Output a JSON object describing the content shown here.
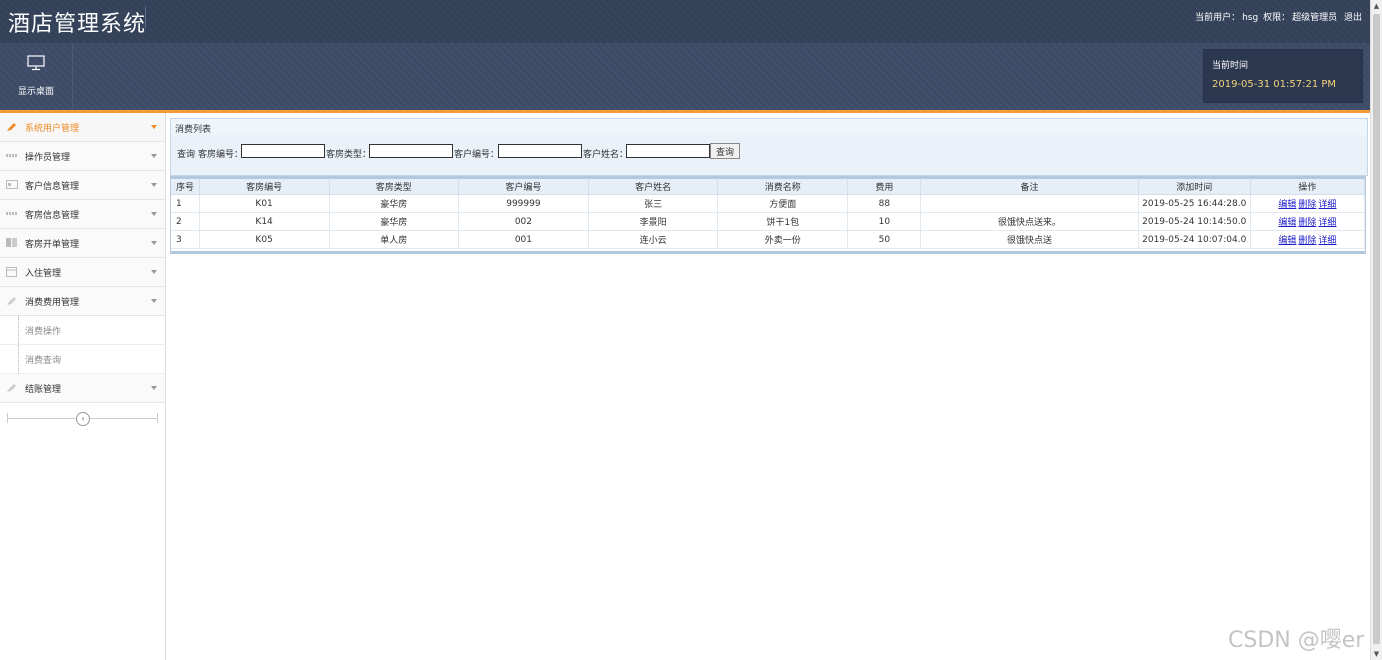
{
  "header": {
    "app_title": "酒店管理系统",
    "user_label": "当前用户：",
    "user_name": "hsg",
    "perm_label": "权限：",
    "perm_value": "超级管理员",
    "logout": "退出"
  },
  "toolbar": {
    "desktop_label": "显示桌面",
    "time_label": "当前时间",
    "time_value": "2019-05-31 01:57:21 PM"
  },
  "sidebar": {
    "items": [
      {
        "label": "系统用户管理",
        "icon": "pencil-icon",
        "active": true
      },
      {
        "label": "操作员管理",
        "icon": "list-icon"
      },
      {
        "label": "客户信息管理",
        "icon": "card-icon"
      },
      {
        "label": "客房信息管理",
        "icon": "list-icon"
      },
      {
        "label": "客房开单管理",
        "icon": "grid-icon"
      },
      {
        "label": "入住管理",
        "icon": "calendar-icon"
      },
      {
        "label": "消费费用管理",
        "icon": "pencil-icon"
      }
    ],
    "sub_items": [
      "消费操作",
      "消费查询"
    ],
    "last_item": {
      "label": "结账管理",
      "icon": "pencil-icon"
    }
  },
  "panel": {
    "title": "消费列表"
  },
  "search": {
    "query_label": "查询",
    "room_no_label": "客房编号：",
    "room_type_label": "客房类型：",
    "customer_no_label": "客户编号：",
    "customer_name_label": "客户姓名：",
    "button": "查询"
  },
  "table": {
    "headers": [
      "序号",
      "客房编号",
      "客房类型",
      "客户编号",
      "客户姓名",
      "消费名称",
      "费用",
      "备注",
      "添加时间",
      "操作"
    ],
    "rows": [
      [
        "1",
        "K01",
        "豪华房",
        "999999",
        "张三",
        "方便面",
        "88",
        "",
        "2019-05-25 16:44:28.0"
      ],
      [
        "2",
        "K14",
        "豪华房",
        "002",
        "李景阳",
        "饼干1包",
        "10",
        "很饿快点送来。",
        "2019-05-24 10:14:50.0"
      ],
      [
        "3",
        "K05",
        "单人房",
        "001",
        "连小云",
        "外卖一份",
        "50",
        "很饿快点送",
        "2019-05-24 10:07:04.0"
      ]
    ],
    "actions": [
      "编辑",
      "删除",
      "详细"
    ]
  },
  "watermark": "CSDN @嘤er",
  "colors": {
    "header_bg": "#334159",
    "accent_orange": "#f29b38",
    "link_blue": "#1d1dcb"
  }
}
